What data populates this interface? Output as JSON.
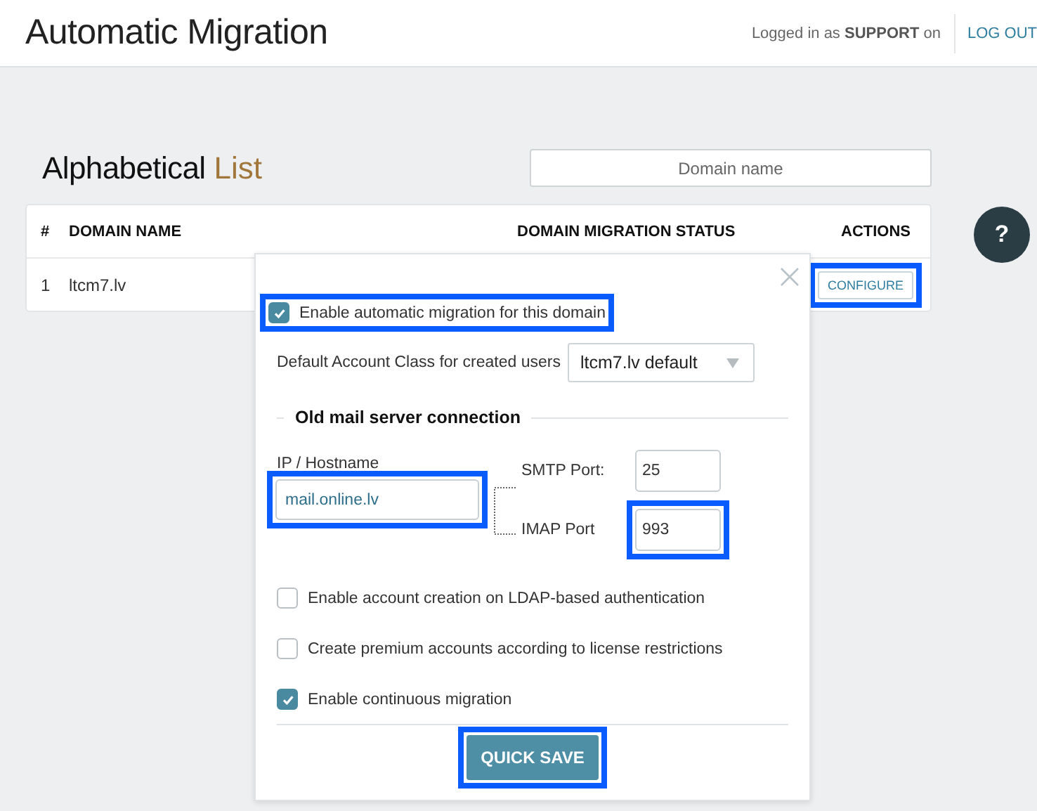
{
  "header": {
    "title": "Automatic Migration",
    "login": "Logged in as **SUPPORT** on",
    "logout": "LOG OUT"
  },
  "list": {
    "title_bold": "Alphabetical",
    "title_light": "List",
    "search": {
      "placeholder": "Domain name"
    }
  },
  "table": {
    "columns": [
      "#",
      "DOMAIN NAME",
      "DOMAIN MIGRATION STATUS",
      "ACTIONS"
    ],
    "rows": [
      {
        "index": "1",
        "domain": "ltcm7.lv",
        "action": {
          "label": "CONFIGURE",
          "highlighted": true
        }
      }
    ]
  },
  "help": {
    "label": "?"
  },
  "popup": {
    "enable": {
      "label": "Enable automatic migration for this domain",
      "checked": true,
      "highlighted": true
    },
    "account_class": {
      "label": "Default Account Class for created users",
      "value": "ltcm7.lv default"
    },
    "section": "Old mail server connection",
    "host": {
      "label": "IP / Hostname",
      "value": "mail.online.lv",
      "highlighted": true
    },
    "ports": [
      {
        "label": "SMTP Port:",
        "value": "25",
        "highlighted": false
      },
      {
        "label": "IMAP Port",
        "value": "993",
        "highlighted": true
      }
    ],
    "options": [
      {
        "label": "Enable account creation on LDAP-based authentication",
        "checked": false
      },
      {
        "label": "Create premium accounts according to license restrictions",
        "checked": false
      },
      {
        "label": "Enable continuous migration",
        "checked": true
      }
    ],
    "save": {
      "label": "QUICK SAVE",
      "highlighted": true
    }
  }
}
